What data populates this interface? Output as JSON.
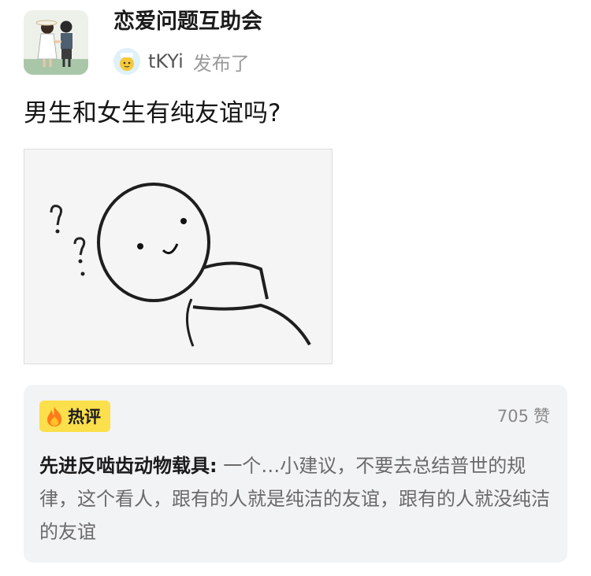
{
  "group": {
    "name": "恋爱问题互助会",
    "avatar_icon": "couple-illustration-icon"
  },
  "author": {
    "name": "tKYi",
    "action": "发布了",
    "avatar_icon": "cartoon-avatar-icon"
  },
  "post": {
    "title": "男生和女生有纯友谊吗?",
    "image_icon": "confused-doodle-face-icon"
  },
  "hot_comment": {
    "badge_label": "热评",
    "badge_icon": "fire-icon",
    "like_count": "705",
    "like_label": "赞",
    "username": "先进反啮齿动物载具:",
    "text": " 一个…小建议，不要去总结普世的规律，这个看人，跟有的人就是纯洁的友谊，跟有的人就没纯洁的友谊"
  },
  "colors": {
    "badge_bg": "#fbdf4b",
    "card_bg": "#f2f3f5",
    "muted_text": "#9a9a9a"
  }
}
